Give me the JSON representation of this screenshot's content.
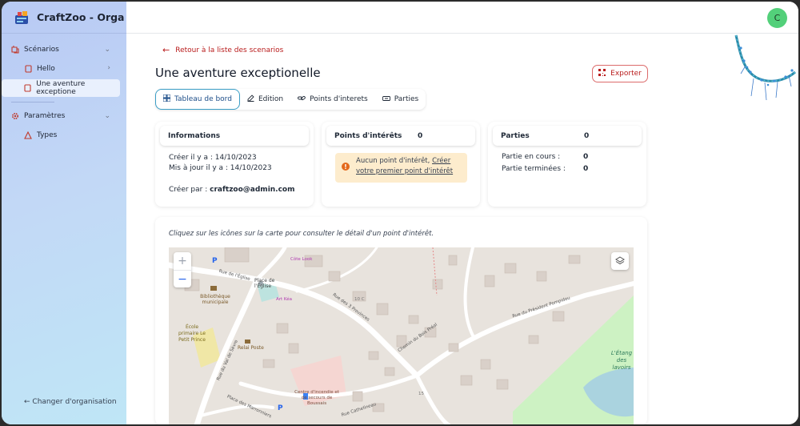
{
  "app": {
    "name": "CraftZoo - Orga"
  },
  "sidebar": {
    "sections": [
      {
        "label": "Scénarios",
        "icon": "scenario-icon",
        "items": [
          {
            "label": "Hello",
            "icon": "book-icon"
          },
          {
            "label": "Une aventure exceptione",
            "icon": "book-icon"
          }
        ]
      },
      {
        "label": "Paramètres",
        "icon": "settings-icon",
        "items": [
          {
            "label": "Types",
            "icon": "triangle-icon"
          }
        ]
      }
    ],
    "change_org": "Changer d'organisation"
  },
  "user": {
    "avatar_letter": "C",
    "avatar_color": "#53d07a"
  },
  "page": {
    "back_link": "Retour à la liste des scenarios",
    "title": "Une aventure exceptionelle",
    "export_label": "Exporter",
    "tabs": [
      {
        "label": "Tableau de bord",
        "icon": "dashboard-icon"
      },
      {
        "label": "Edition",
        "icon": "edit-icon"
      },
      {
        "label": "Points d'interets",
        "icon": "link-icon"
      },
      {
        "label": "Parties",
        "icon": "ticket-icon"
      }
    ]
  },
  "info_card": {
    "title": "Informations",
    "created": "Créer il y a : 14/10/2023",
    "updated": "Mis à jour il y a : 14/10/2023",
    "created_by_label": "Créer par :",
    "created_by_value": "craftzoo@admin.com"
  },
  "poi_card": {
    "title": "Points d'intérêts",
    "count": "0",
    "warning_text": "Aucun point d'intérêt,",
    "warning_link_1": "Créer",
    "warning_link_2": "votre premier point d'intérêt"
  },
  "parties_card": {
    "title": "Parties",
    "count": "0",
    "rows": [
      {
        "label": "Partie en cours :",
        "value": "0"
      },
      {
        "label": "Partie terminées :",
        "value": "0"
      }
    ]
  },
  "map": {
    "hint": "Cliquez sur les icônes sur la carte pour consulter le détail d'un point d'intérêt.",
    "zoom_in": "+",
    "zoom_out": "−",
    "labels": {
      "place": "Place de l'Église",
      "place_street": "Place de l'Église",
      "bibliotheque": "Bibliothèque municipale",
      "ecole": "École primaire Le Petit Prince",
      "relai": "Relai Poste",
      "centre": "Centre d'incendie et de secours de Boussais",
      "etang": "L'Étang des lavoirs",
      "r_val": "Rue du Val de Sèvre",
      "r_prov": "Rue des 3 Provinces",
      "r_pres": "Rue du Président Pompidou",
      "r_bois": "Chemin du Bois Préal",
      "r_cath": "Rue Cathelineau",
      "r_marr": "Place des Marronniers",
      "r_egl": "Rue de l'Église",
      "cote": "Côte Look",
      "art": "Art Kéa",
      "n15": "15",
      "n10c": "10 C",
      "p": "P"
    }
  }
}
